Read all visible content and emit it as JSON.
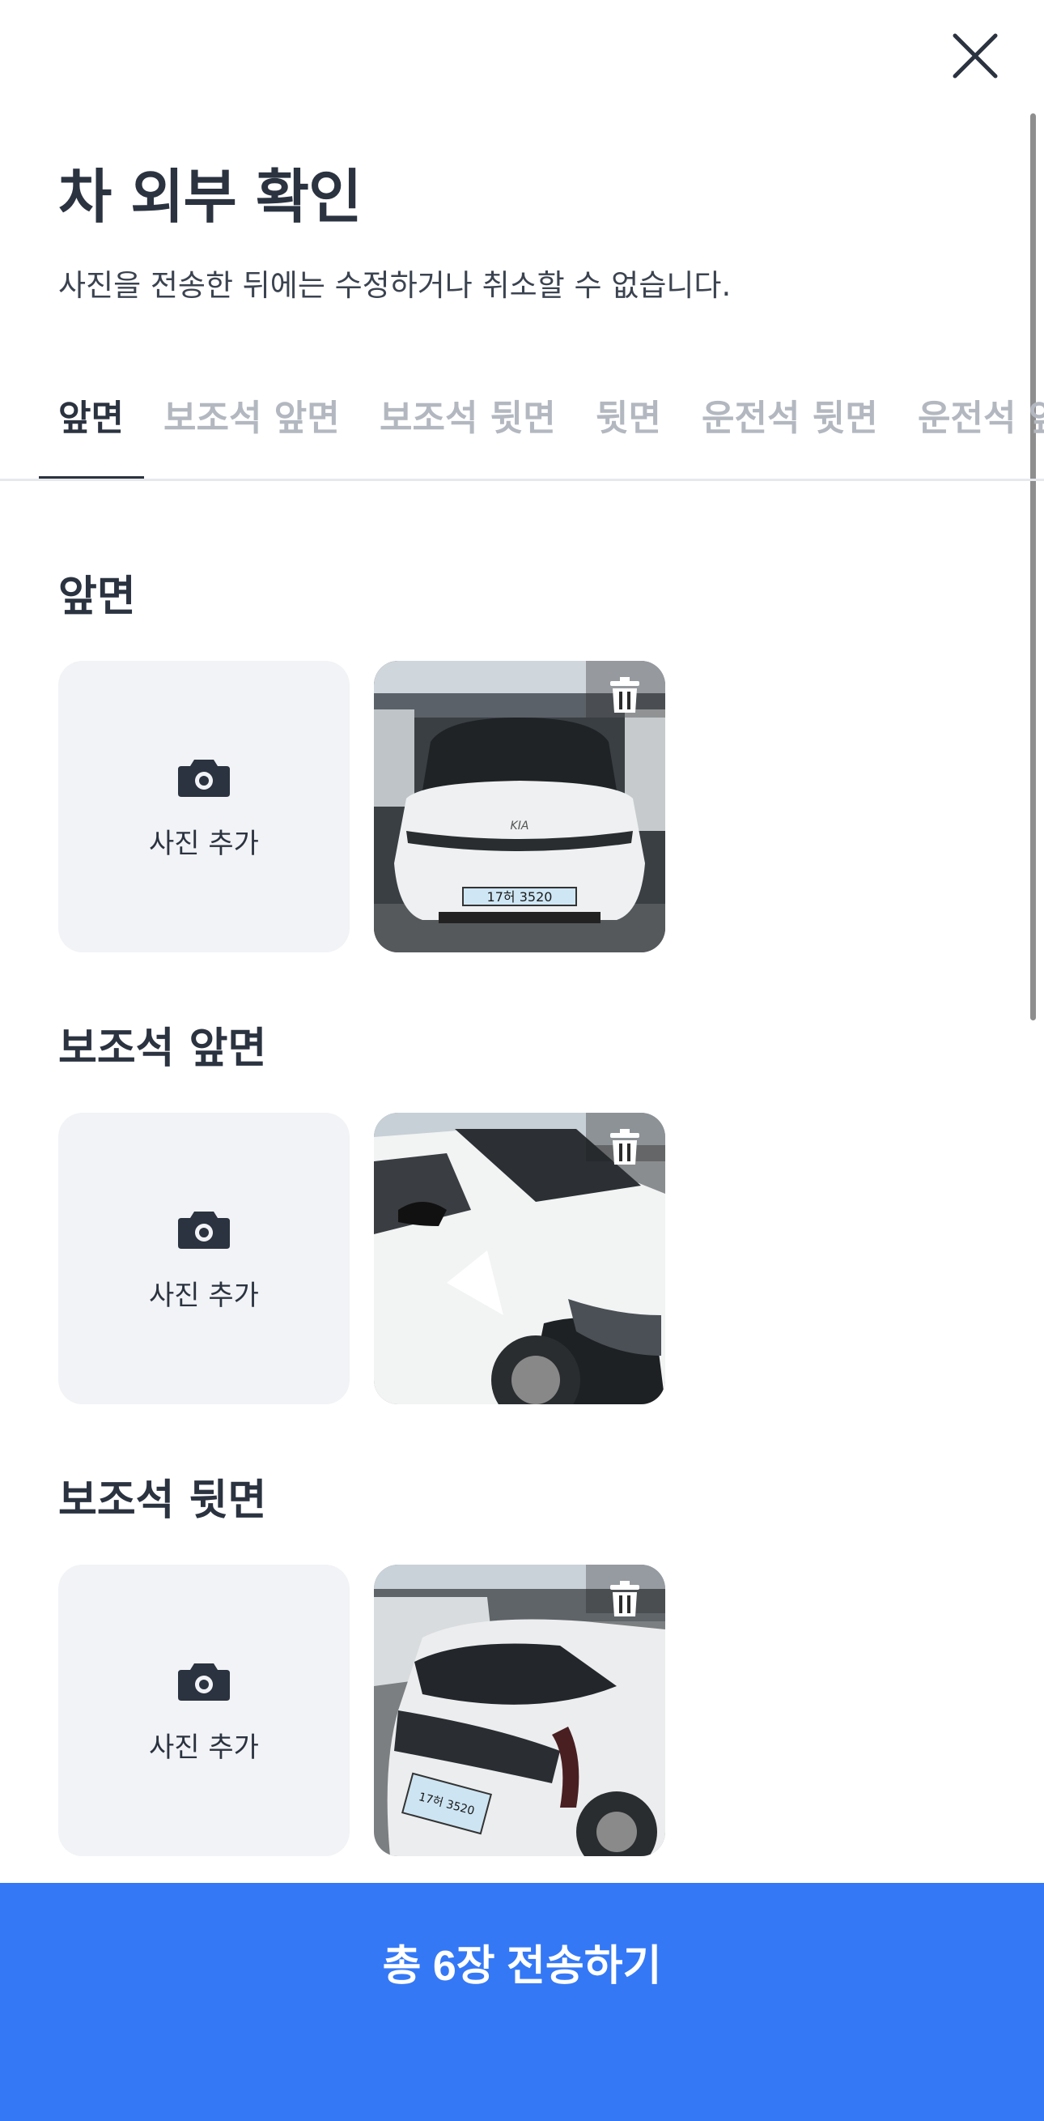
{
  "header": {
    "title": "차 외부 확인",
    "subtitle": "사진을 전송한 뒤에는 수정하거나 취소할 수 없습니다."
  },
  "tabs": [
    {
      "label": "앞면",
      "active": true
    },
    {
      "label": "보조석 앞면",
      "active": false
    },
    {
      "label": "보조석 뒷면",
      "active": false
    },
    {
      "label": "뒷면",
      "active": false
    },
    {
      "label": "운전석 뒷면",
      "active": false
    },
    {
      "label": "운전석 앞면",
      "active": false
    }
  ],
  "sections": [
    {
      "title": "앞면",
      "add_label": "사진 추가",
      "plate": "17허 3520"
    },
    {
      "title": "보조석 앞면",
      "add_label": "사진 추가"
    },
    {
      "title": "보조석 뒷면",
      "add_label": "사진 추가",
      "plate": "17허 3520"
    }
  ],
  "submit": {
    "label": "총 6장 전송하기"
  },
  "icons": [
    "close-icon",
    "camera-icon",
    "trash-icon"
  ],
  "colors": {
    "accent": "#3478f6",
    "text": "#2b3340",
    "muted": "#b3b8c0",
    "tile_bg": "#f2f3f6"
  }
}
